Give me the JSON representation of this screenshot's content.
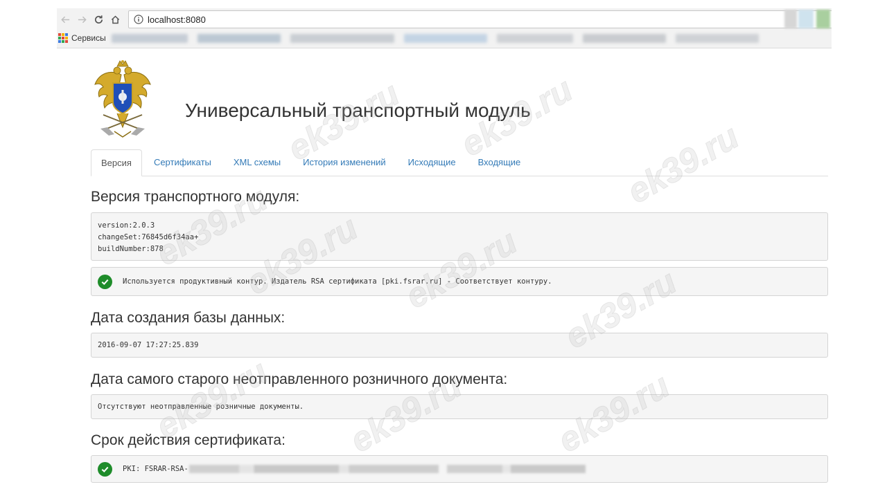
{
  "browser": {
    "url": "localhost:8080",
    "bookmarks_label": "Сервисы"
  },
  "app": {
    "title": "Универсальный транспортный модуль"
  },
  "tabs": [
    {
      "label": "Версия",
      "active": true
    },
    {
      "label": "Сертификаты",
      "active": false
    },
    {
      "label": "XML схемы",
      "active": false
    },
    {
      "label": "История изменений",
      "active": false
    },
    {
      "label": "Исходящие",
      "active": false
    },
    {
      "label": "Входящие",
      "active": false
    }
  ],
  "sections": {
    "version": {
      "title": "Версия транспортного модуля:",
      "lines": [
        "version:2.0.3",
        "changeSet:76845d6f34aa+",
        "buildNumber:878"
      ],
      "status_text": "Используется продуктивный контур. Издатель RSA сертификата [pki.fsrar.ru] - Соответствует контуру."
    },
    "db_created": {
      "title": "Дата создания базы данных:",
      "value": "2016-09-07 17:27:25.839"
    },
    "oldest_unsent": {
      "title": "Дата самого старого неотправленного розничного документа:",
      "value": "Отсутствуют неотправленные розничные документы."
    },
    "cert_validity": {
      "title": "Срок действия сертификата:",
      "value": "PKI: FSRAR-RSA-"
    }
  },
  "watermark": "ek39.ru",
  "colors": {
    "link": "#337ab7",
    "success": "#1e8c2a",
    "well_bg": "#f5f5f5"
  }
}
